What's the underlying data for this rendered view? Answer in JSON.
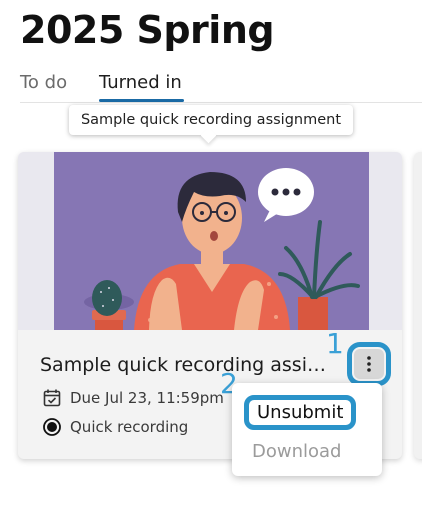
{
  "header": {
    "title": "2025 Spring"
  },
  "tabs": [
    {
      "label": "To do",
      "active": false
    },
    {
      "label": "Turned in",
      "active": true
    }
  ],
  "tooltip": {
    "text": "Sample quick recording assignment"
  },
  "card": {
    "title": "Sample quick recording assignm...",
    "due": "Due Jul 23, 11:59pm",
    "type": "Quick recording",
    "icons": {
      "due": "calendar-check-icon",
      "type": "record-dot-icon",
      "more": "more-vertical-icon"
    }
  },
  "menu": {
    "items": [
      {
        "label": "Unsubmit",
        "enabled": true
      },
      {
        "label": "Download",
        "enabled": false
      }
    ]
  },
  "annotations": {
    "step1": "1",
    "step2": "2"
  },
  "colors": {
    "accent": "#2a93c9",
    "tab_underline": "#1a6aa5",
    "thumbnail_bg": "#8676b4"
  }
}
